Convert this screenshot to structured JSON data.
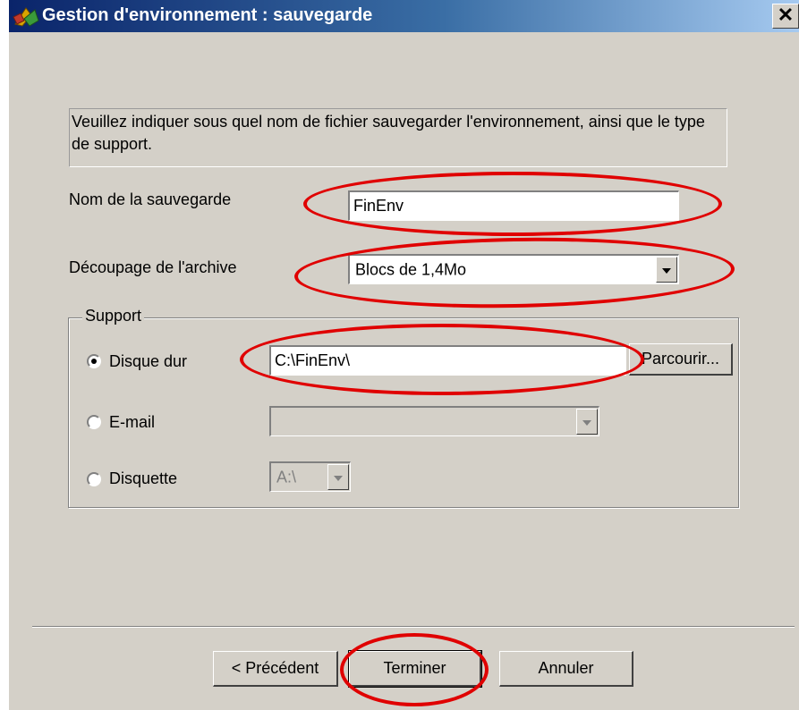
{
  "window": {
    "title": "Gestion d'environnement : sauvegarde",
    "close_glyph": "✕"
  },
  "instruction": "Veuillez indiquer sous quel nom de fichier sauvegarder l'environnement, ainsi que le type de support.",
  "backup_name": {
    "label": "Nom de la sauvegarde",
    "value": "FinEnv"
  },
  "archive_split": {
    "label": "Découpage de l'archive",
    "selected": "Blocs de 1,4Mo"
  },
  "support": {
    "legend": "Support",
    "options": [
      {
        "label": "Disque dur",
        "checked": true
      },
      {
        "label": "E-mail",
        "checked": false
      },
      {
        "label": "Disquette",
        "checked": false
      }
    ],
    "hard_disk_path": "C:\\FinEnv\\",
    "browse_label": "Parcourir...",
    "email_value": "",
    "floppy_drive": "A:\\"
  },
  "buttons": {
    "previous": "< Précédent",
    "finish": "Terminer",
    "cancel": "Annuler"
  },
  "colors": {
    "title_bar_start": "#0a246a",
    "title_bar_end": "#a6caf0",
    "dialog_bg": "#d4d0c8",
    "annotation": "#e00000"
  }
}
